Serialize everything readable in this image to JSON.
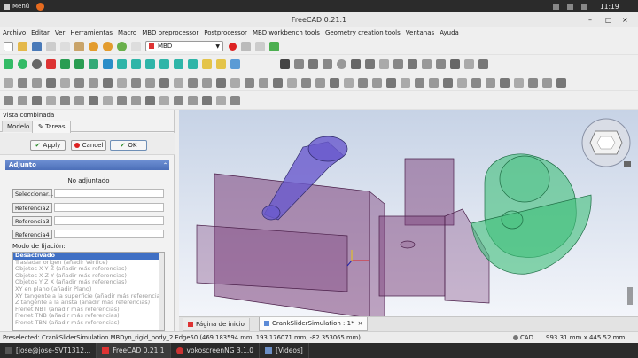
{
  "system": {
    "menu_label": "Menú",
    "clock": "11:19"
  },
  "window": {
    "title": "FreeCAD 0.21.1"
  },
  "menu": [
    "Archivo",
    "Editar",
    "Ver",
    "Herramientas",
    "Macro",
    "MBD preprocessor",
    "Postprocessor",
    "MBD workbench tools",
    "Geometry creation tools",
    "Ventanas",
    "Ayuda"
  ],
  "toolbar": {
    "workbench": "MBD"
  },
  "panel": {
    "title": "Vista combinada",
    "tabs": [
      "Modelo",
      "Tareas"
    ],
    "apply": "Apply",
    "cancel": "Cancel",
    "ok": "OK",
    "section": "Adjunto",
    "not_attached": "No adjuntado",
    "select_btn": "Seleccionar...",
    "refs": [
      "Referencia2",
      "Referencia3",
      "Referencia4"
    ],
    "mode_label": "Modo de fijación:",
    "modes": [
      "Desactivado",
      "Trasladar origen (añadir Vértice)",
      "Objetos X Y Z (añadir más referencias)",
      "Objetos X Z Y (añadir más referencias)",
      "Objetos Y Z X (añadir más referencias)",
      "XY en plano (añadir Plano)",
      "XY tangente a la superficie (añadir más referencias)",
      "Z tangente a la arista (añadir más referencias)",
      "Frenet NBT (añadir más referencias)",
      "Frenet TNB (añadir más referencias)",
      "Frenet TBN (añadir más referencias)"
    ]
  },
  "viewport": {
    "tabs": [
      "Página de inicio",
      "CrankSliderSimulation : 1*"
    ]
  },
  "status": {
    "preselected": "Preselected: CrankSliderSimulation.MBDyn_rigid_body_2.Edge50 (469.183594 mm, 193.176071 mm, -82.353065 mm)",
    "nav": "CAD",
    "dims": "993.31 mm x 445.52 mm"
  },
  "taskbar": [
    "[jose@jose-SVT1312...",
    "FreeCAD 0.21.1",
    "vokoscreenNG 3.1.0",
    "[Videos]"
  ],
  "colors": {
    "purple": "#7b3f7a",
    "green": "#3fbf7a",
    "shaft": "#6a5acd"
  }
}
